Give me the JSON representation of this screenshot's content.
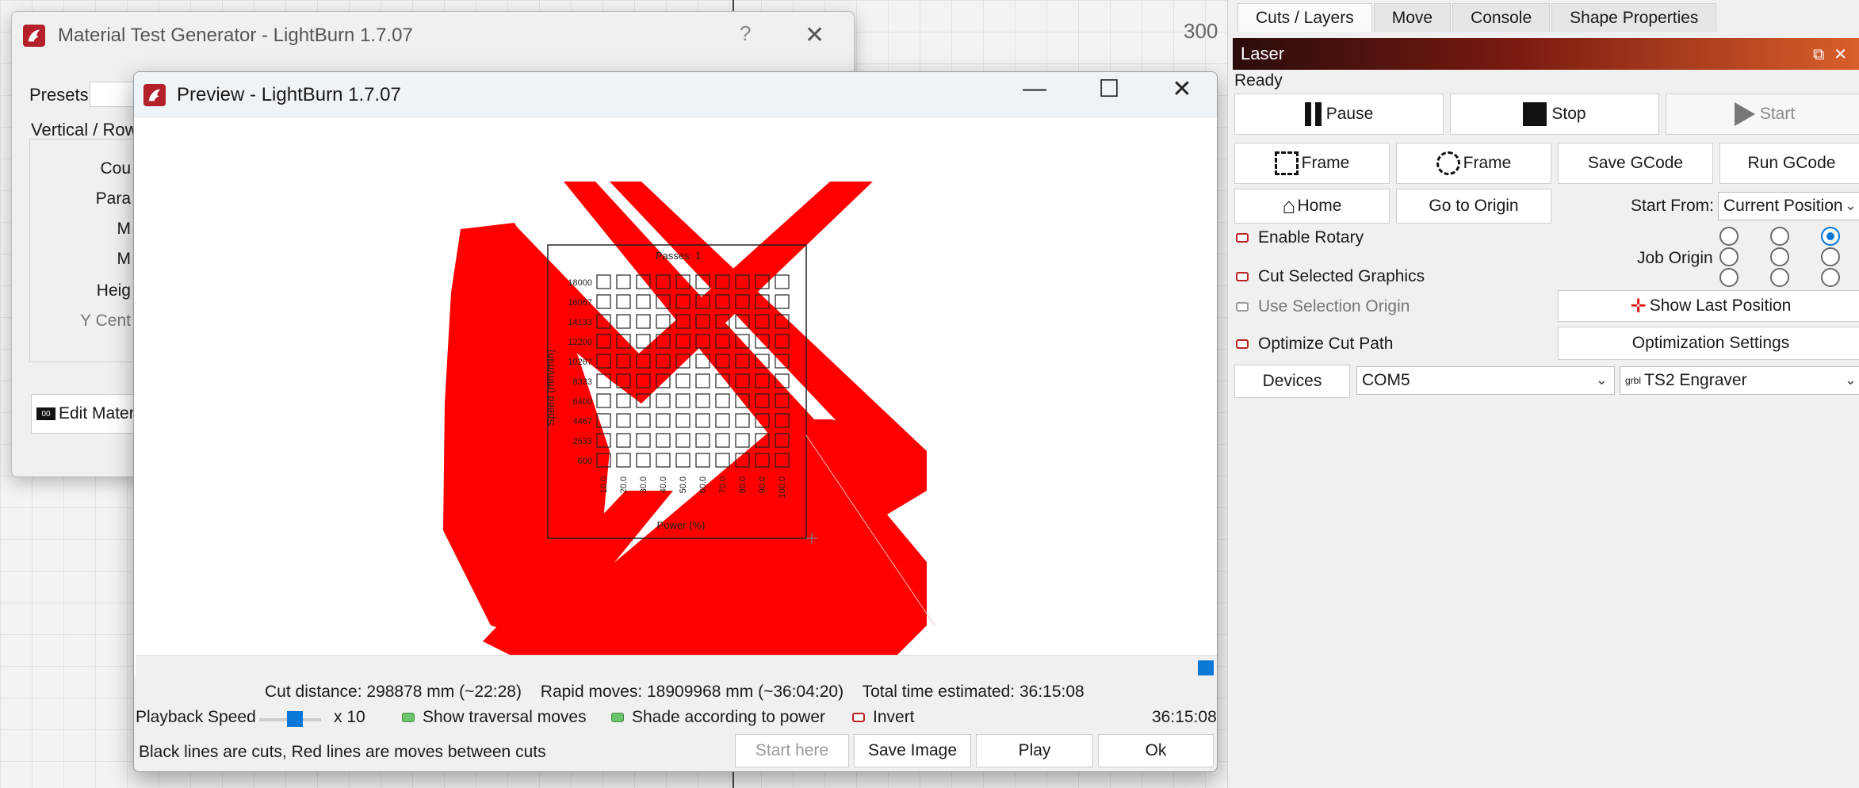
{
  "canvas": {
    "ruler_value": "300"
  },
  "mtg": {
    "title": "Material Test Generator - LightBurn 1.7.07",
    "help_glyph": "?",
    "close_glyph": "✕",
    "presets_label": "Presets",
    "section_label": "Vertical / Row",
    "fields": [
      "Cou",
      "Para",
      "M",
      "M",
      "Heig",
      "Y Cent"
    ],
    "edit_label": "Edit Materi",
    "edit_icon_text": "00"
  },
  "preview": {
    "title": "Preview - LightBurn 1.7.07",
    "min_glyph": "—",
    "max_glyph": "☐",
    "close_glyph": "✕",
    "canvas_text": {
      "passes": "Passes: 1",
      "speed_axis": "Speed (mm/min)",
      "power_axis": "Power (%)",
      "speeds": [
        "18000",
        "16067",
        "14133",
        "12200",
        "10267",
        "8333",
        "6400",
        "4467",
        "2533",
        "600"
      ],
      "powers": [
        "10.0",
        "20.0",
        "30.0",
        "40.0",
        "50.0",
        "60.0",
        "70.0",
        "80.0",
        "90.0",
        "100.0"
      ]
    },
    "stats": {
      "cut_distance": "Cut distance: 298878 mm (~22:28)",
      "rapid_moves": "Rapid moves: 18909968 mm (~36:04:20)",
      "total_time": "Total time estimated: 36:15:08"
    },
    "playback_label": "Playback Speed",
    "playback_multiplier": "x 10",
    "playback_position": 0.6,
    "show_traversal": "Show traversal moves",
    "shade_power": "Shade according to power",
    "invert": "Invert",
    "elapsed": "36:15:08",
    "hint": "Black lines are cuts, Red lines are moves between cuts",
    "buttons": {
      "start_here": "Start here",
      "save_image": "Save Image",
      "play": "Play",
      "ok": "Ok"
    }
  },
  "right": {
    "tabs": [
      "Cuts / Layers",
      "Move",
      "Console",
      "Shape Properties"
    ],
    "laser_title": "Laser",
    "status": "Ready",
    "pause": "Pause",
    "stop": "Stop",
    "start": "Start",
    "frame1": "Frame",
    "frame2": "Frame",
    "save_gcode": "Save GCode",
    "run_gcode": "Run GCode",
    "home": "Home",
    "go_origin": "Go to Origin",
    "start_from_label": "Start From:",
    "start_from_value": "Current Position",
    "enable_rotary": "Enable Rotary",
    "job_origin_label": "Job Origin",
    "cut_selected": "Cut Selected Graphics",
    "use_selection_origin": "Use Selection Origin",
    "show_last_position": "Show Last Position",
    "optimize_cut_path": "Optimize Cut Path",
    "optimization_settings": "Optimization Settings",
    "devices": "Devices",
    "port": "COM5",
    "device_prefix": "grbl",
    "device": "TS2 Engraver"
  },
  "colors": {
    "accent": "#0a78d7",
    "laser_red": "#ff0000",
    "brand": "#b3202a"
  }
}
